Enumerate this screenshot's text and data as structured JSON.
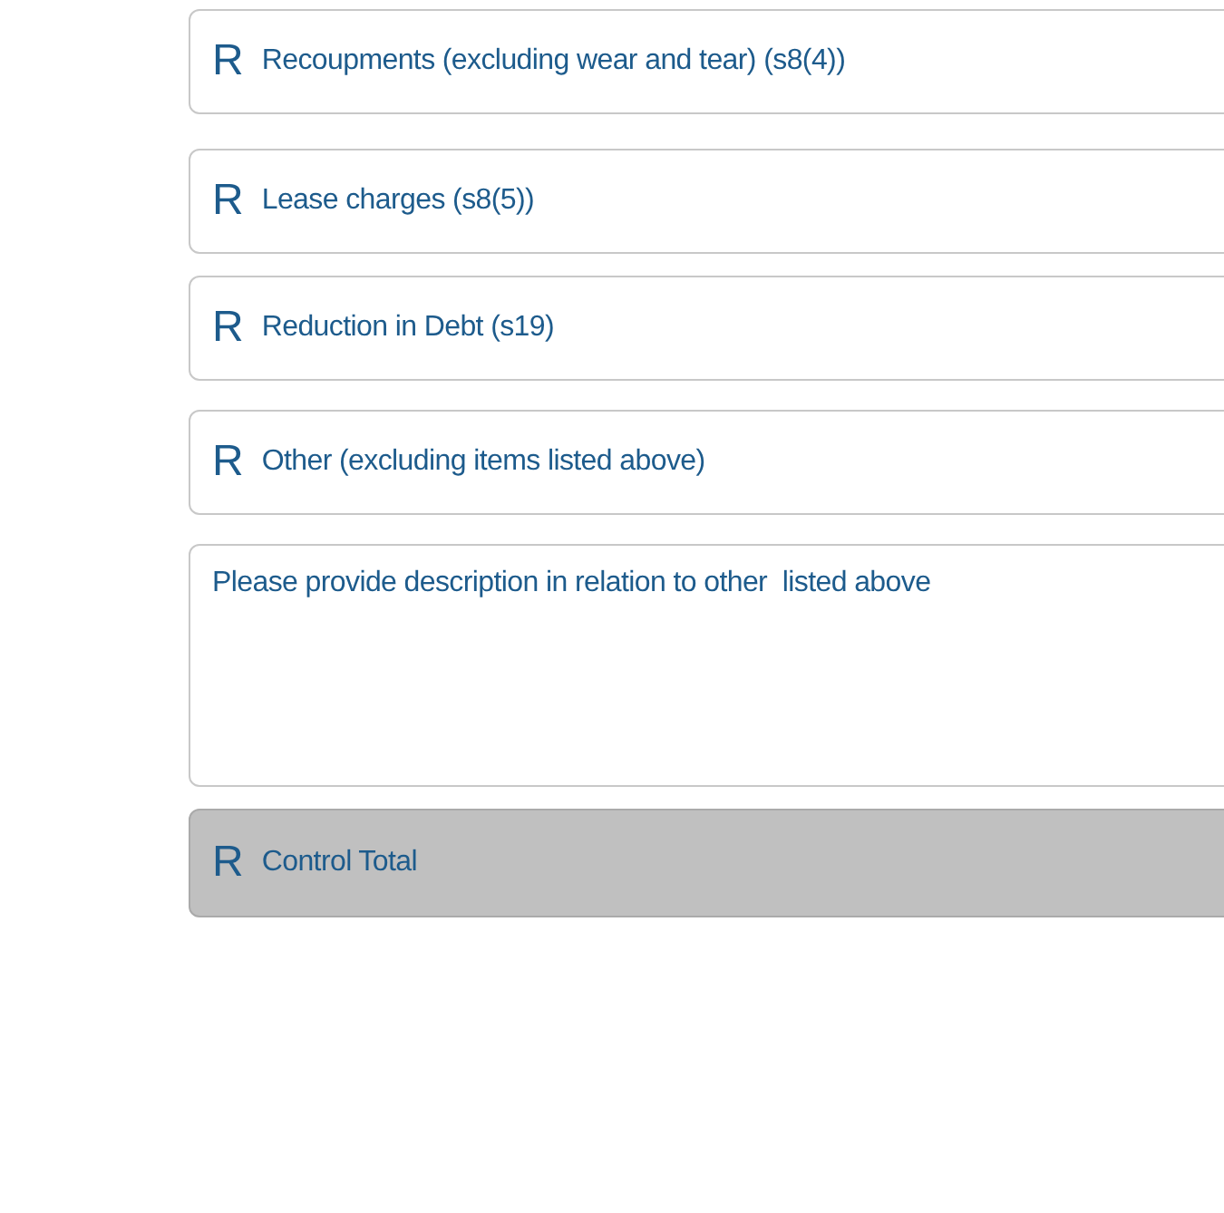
{
  "rows": [
    {
      "kind": "field",
      "marker": "R",
      "label": "Recoupments (excluding wear and tear) (s8(4))"
    },
    {
      "kind": "field",
      "marker": "R",
      "label": "Lease charges (s8(5))"
    },
    {
      "kind": "field",
      "marker": "R",
      "label": "Reduction in Debt (s19)"
    },
    {
      "kind": "field",
      "marker": "R",
      "label": "Other (excluding items listed above)"
    },
    {
      "kind": "textarea",
      "placeholder": "Please provide description in relation to other  listed above"
    },
    {
      "kind": "total",
      "marker": "R",
      "label": "Control Total"
    }
  ]
}
